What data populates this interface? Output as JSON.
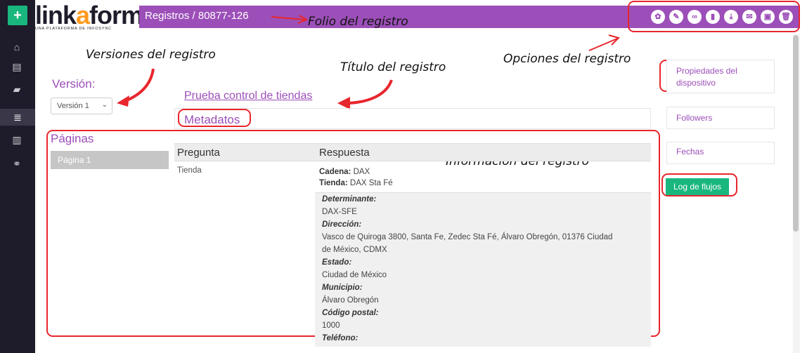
{
  "sidebar": {
    "plus": "+",
    "icons": [
      "home-icon",
      "file-icon",
      "book-icon",
      "list-icon",
      "chart-icon",
      "link-icon"
    ]
  },
  "logo": {
    "part1": "link",
    "part2": "a",
    "part3": "form",
    "subtitle": "UNA PLATAFORMA DE INFOSYNC"
  },
  "topbar": {
    "breadcrumb": "Registros / 80877-126",
    "tools": [
      "gear-icon",
      "pencil-icon",
      "binoculars-icon",
      "document-icon",
      "download-icon",
      "envelope-icon",
      "archive-icon",
      "trash-icon"
    ]
  },
  "annotations": {
    "folio": "Folio del registro",
    "versiones": "Versiones del registro",
    "titulo": "Título del registro",
    "opciones": "Opciones del registro",
    "informacion": "Información del registro"
  },
  "version": {
    "label": "Versión:",
    "selected": "Versión 1"
  },
  "pages": {
    "label": "Páginas",
    "items": [
      "Página 1"
    ]
  },
  "record": {
    "title": "Prueba control de tiendas",
    "metadata": "Metadatos"
  },
  "table": {
    "headers": {
      "question": "Pregunta",
      "answer": "Respuesta"
    },
    "row_question": "Tienda",
    "cadena_k": "Cadena:",
    "cadena_v": "DAX",
    "tienda_k": "Tienda:",
    "tienda_v": "DAX Sta Fé",
    "details": [
      {
        "k": "Determinante:",
        "v": "DAX-SFE"
      },
      {
        "k": "Dirección:",
        "v": "Vasco de Quiroga 3800, Santa Fe, Zedec Sta Fé, Álvaro Obregón, 01376 Ciudad",
        "v2": "de México, CDMX"
      },
      {
        "k": "Estado:",
        "v": "Ciudad de México"
      },
      {
        "k": "Municipio:",
        "v": "Álvaro Obregón"
      },
      {
        "k": "Código postal:",
        "v": "1000"
      },
      {
        "k": "Teléfono:",
        "v": ""
      }
    ]
  },
  "right": {
    "props": "Propiedades del",
    "props2": "dispositivo",
    "followers": "Followers",
    "fechas": "Fechas",
    "log": "Log de flujos"
  },
  "colors": {
    "purple": "#9c4fb8",
    "green": "#19b77e",
    "dark": "#1e1c2a",
    "annotation": "#e8262d"
  }
}
